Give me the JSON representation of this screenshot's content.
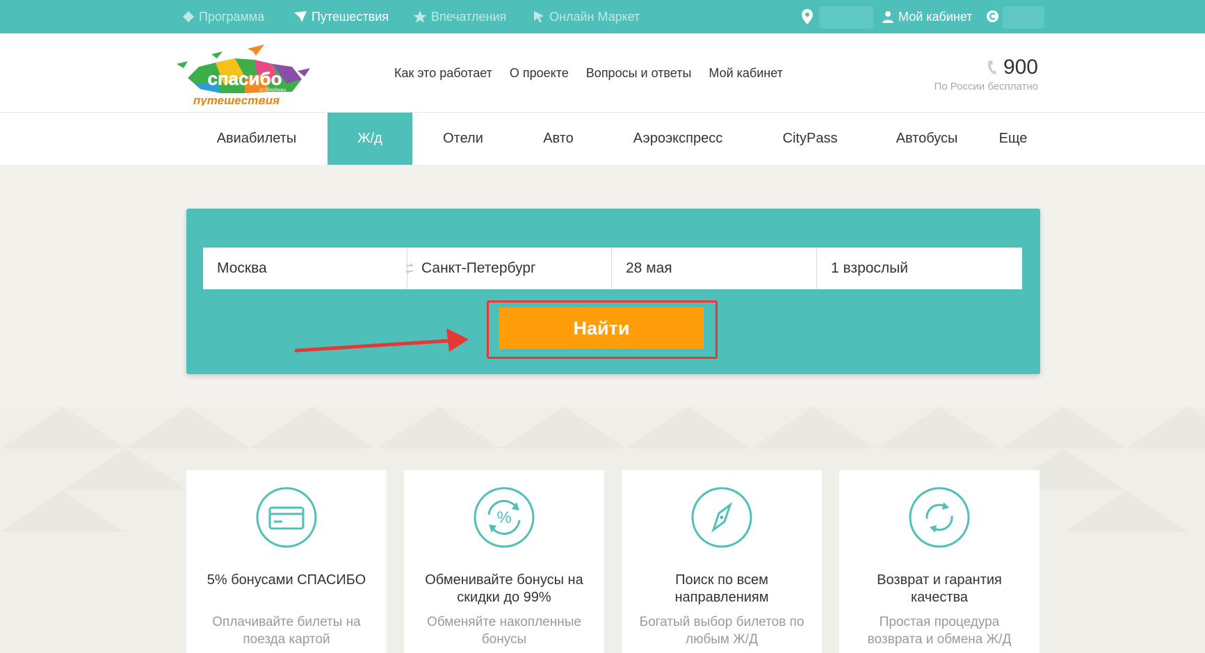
{
  "topbar": {
    "items": [
      {
        "label": "Программа",
        "icon": "diamond-icon"
      },
      {
        "label": "Путешествия",
        "icon": "paper-plane-icon"
      },
      {
        "label": "Впечатления",
        "icon": "star-icon"
      },
      {
        "label": "Онлайн Маркет",
        "icon": "cursor-icon"
      }
    ],
    "location_icon": "location-pin-icon",
    "account_label": "Мой кабинет",
    "account_icon": "user-icon",
    "currency_icon": "spasibo-coin-icon"
  },
  "header": {
    "logo": {
      "brand": "спасибо",
      "sub": "путешествия",
      "tagline": "от Сбербанка"
    },
    "nav": [
      "Как это работает",
      "О проекте",
      "Вопросы и ответы",
      "Мой кабинет"
    ],
    "phone": "900",
    "phone_note": "По России бесплатно"
  },
  "tabs": [
    "Авиабилеты",
    "Ж/д",
    "Отели",
    "Авто",
    "Аэроэкспресс",
    "CityPass",
    "Автобусы",
    "Еще"
  ],
  "active_tab": "Ж/д",
  "search": {
    "from": "Москва",
    "to": "Санкт-Петербург",
    "date": "28 мая",
    "passengers": "1 взрослый",
    "button": "Найти"
  },
  "colors": {
    "accent": "#4fbfb9",
    "button": "#ff9e0a",
    "highlight": "#e53935"
  },
  "features": [
    {
      "icon": "credit-card-icon",
      "title": "5% бонусами СПАСИБО",
      "desc": "Оплачивайте билеты на поезда картой"
    },
    {
      "icon": "percent-exchange-icon",
      "title": "Обменивайте бонусы на скидки до 99%",
      "desc": "Обменяйте накопленные бонусы"
    },
    {
      "icon": "compass-icon",
      "title": "Поиск по всем направлениям",
      "desc": "Богатый выбор билетов по любым Ж/Д"
    },
    {
      "icon": "refresh-icon",
      "title": "Возврат и гарантия качества",
      "desc": "Простая процедура возврата и обмена Ж/Д"
    }
  ]
}
